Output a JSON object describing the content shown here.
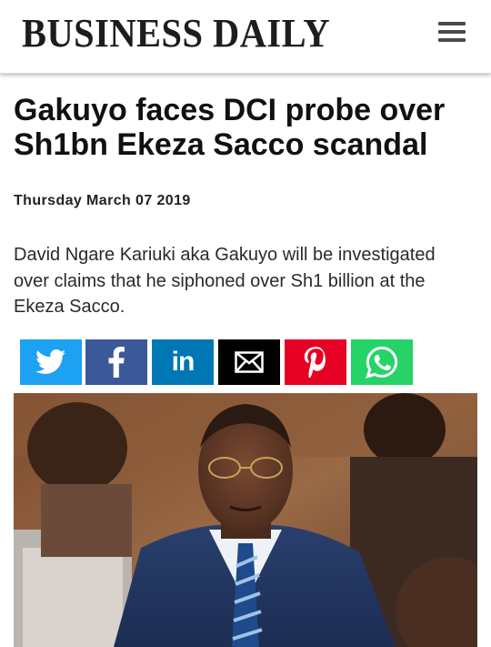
{
  "header": {
    "logo_text": "BUSINESS DAILY",
    "menu_icon": "hamburger-menu-icon"
  },
  "article": {
    "headline": "Gakuyo faces DCI probe over Sh1bn Ekeza Sacco scandal",
    "date": "Thursday March 07 2019",
    "summary": "David Ngare Kariuki aka Gakuyo will be investigated over claims that he siphoned over Sh1 billion at the Ekeza Sacco."
  },
  "share": [
    {
      "name": "twitter",
      "icon": "twitter-icon",
      "color": "#1da1f2"
    },
    {
      "name": "facebook",
      "icon": "facebook-icon",
      "color": "#3b5998"
    },
    {
      "name": "linkedin",
      "icon": "linkedin-icon",
      "color": "#0077b5"
    },
    {
      "name": "email",
      "icon": "envelope-icon",
      "color": "#000000"
    },
    {
      "name": "pinterest",
      "icon": "pinterest-icon",
      "color": "#e60023"
    },
    {
      "name": "whatsapp",
      "icon": "whatsapp-icon",
      "color": "#25d366"
    }
  ],
  "photo": {
    "subject": "man-in-suit-photo"
  }
}
